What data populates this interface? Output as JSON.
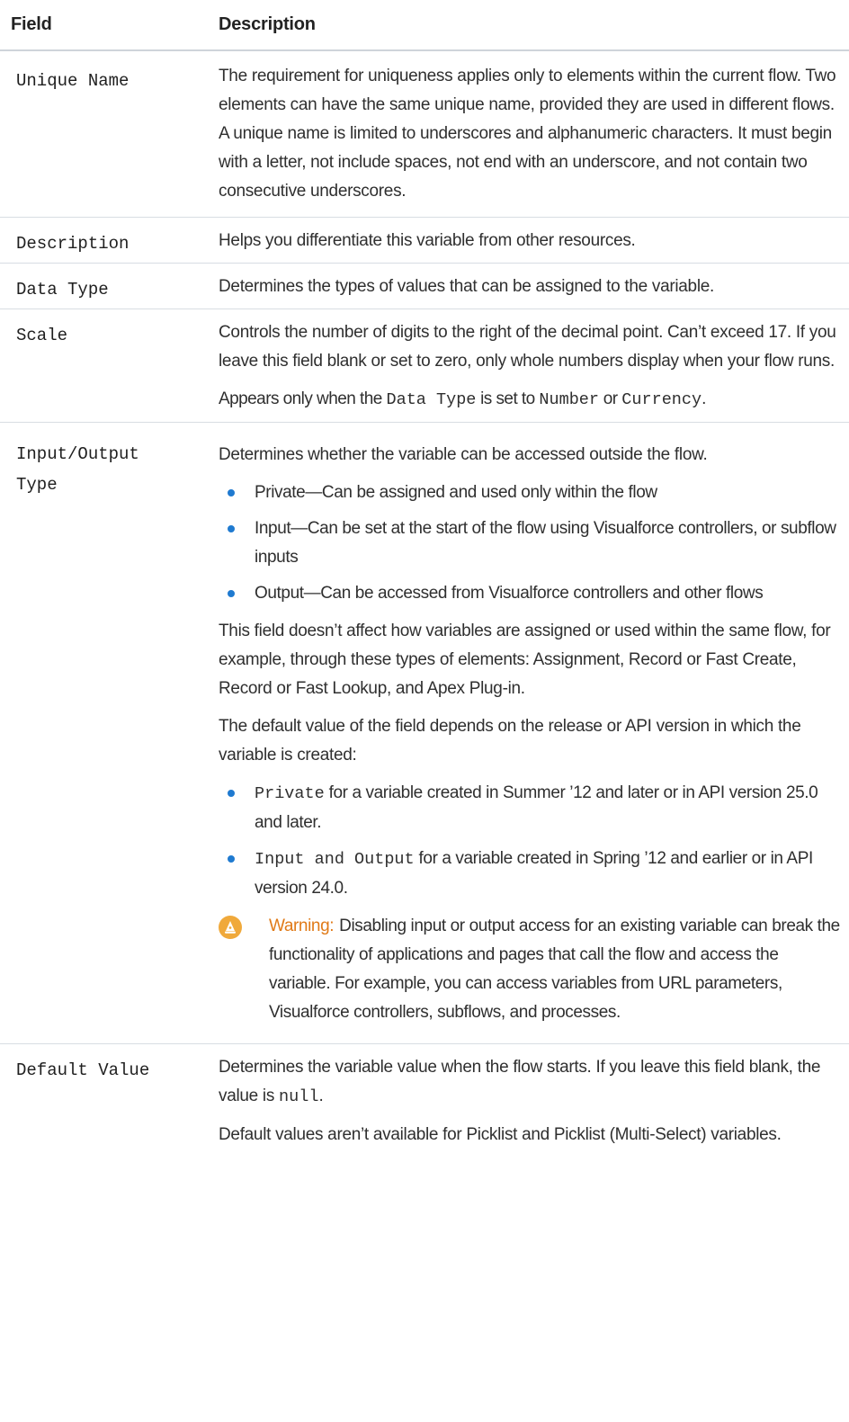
{
  "header": {
    "field": "Field",
    "description": "Description"
  },
  "rows": {
    "unique_name": {
      "field": "Unique Name",
      "p1": "The requirement for uniqueness applies only to elements within the current flow. Two elements can have the same unique name, provided they are used in different flows. A unique name is limited to underscores and alphanumeric characters. It must begin with a letter, not include spaces, not end with an underscore, and not contain two consecutive underscores."
    },
    "description": {
      "field": "Description",
      "p1": "Helps you differentiate this variable from other resources."
    },
    "data_type": {
      "field": "Data Type",
      "p1": "Determines the types of values that can be assigned to the variable."
    },
    "scale": {
      "field": "Scale",
      "p1": "Controls the number of digits to the right of the decimal point. Can’t exceed 17. If you leave this field blank or set to zero, only whole numbers display when your flow runs.",
      "p2_a": "Appears only when the ",
      "p2_code1": "Data Type",
      "p2_b": " is set to ",
      "p2_code2": "Number",
      "p2_c": " or ",
      "p2_code3": "Currency",
      "p2_d": "."
    },
    "io_type": {
      "field": "Input/Output Type",
      "p1": "Determines whether the variable can be accessed outside the flow.",
      "bullets": [
        "Private—Can be assigned and used only within the flow",
        "Input—Can be set at the start of the flow using Visualforce controllers, or subflow inputs",
        "Output—Can be accessed from Visualforce controllers and other flows"
      ],
      "p2": "This field doesn’t affect how variables are assigned or used within the same flow, for example, through these types of elements: Assignment, Record or Fast Create, Record or Fast Lookup, and Apex Plug-in.",
      "p3": "The default value of the field depends on the release or API version in which the variable is created:",
      "defaults": [
        {
          "code": "Private",
          "text": " for a variable created in Summer ’12 and later or in API version 25.0 and later."
        },
        {
          "code": "Input and Output",
          "text": " for a variable created in Spring ’12 and earlier or in API version 24.0."
        }
      ],
      "warning_label": "Warning:",
      "warning_text": "Disabling input or output access for an existing variable can break the functionality of applications and pages that call the flow and access the variable. For example, you can access variables from URL parameters, Visualforce controllers, subflows, and processes."
    },
    "default_value": {
      "field": "Default Value",
      "p1_a": "Determines the variable value when the flow starts. If you leave this field blank, the value is ",
      "p1_code": "null",
      "p1_b": ".",
      "p2": "Default values aren’t available for Picklist and Picklist (Multi-Select) variables."
    }
  },
  "colors": {
    "bullet": "#1f7ad0",
    "warning_label": "#e07a18",
    "warning_icon": "#f0a93b",
    "divider": "#d8dde3"
  }
}
